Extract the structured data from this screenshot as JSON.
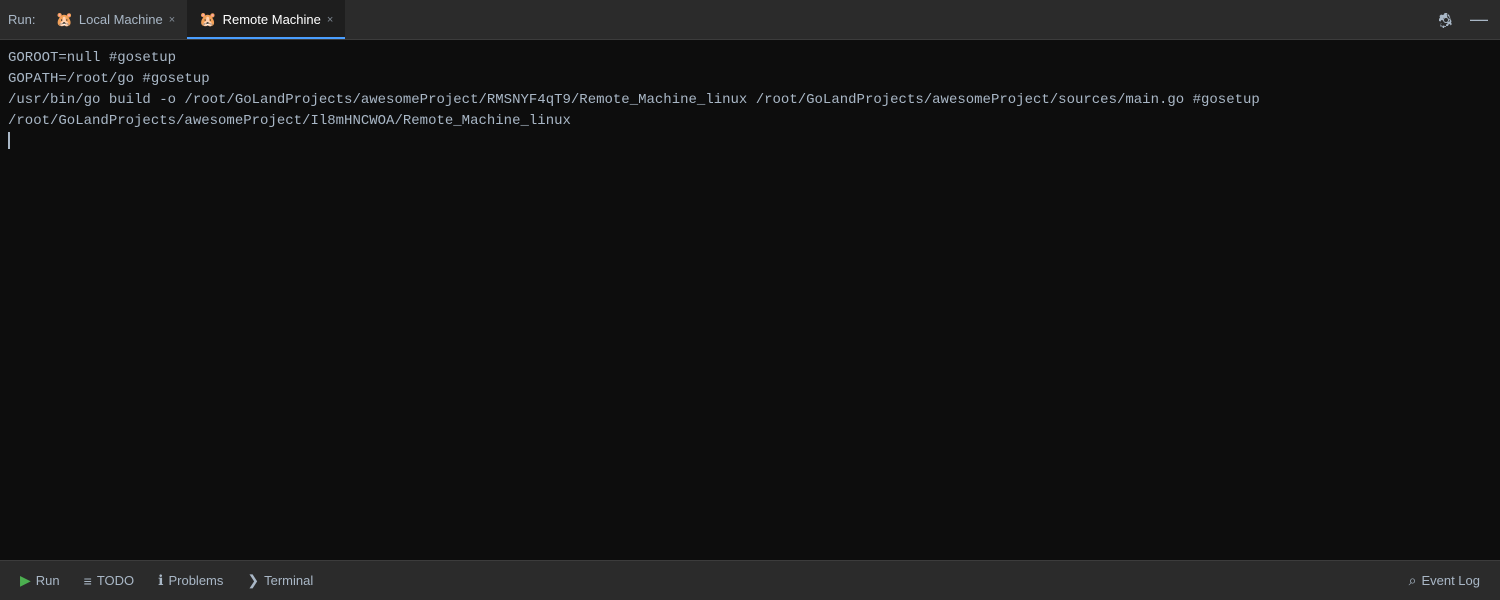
{
  "header": {
    "run_label": "Run:",
    "tabs": [
      {
        "id": "local",
        "label": "Local Machine",
        "icon": "🐹",
        "active": false,
        "closable": true
      },
      {
        "id": "remote",
        "label": "Remote Machine",
        "icon": "🐹",
        "active": true,
        "closable": true
      }
    ]
  },
  "output": {
    "lines": [
      "GOROOT=null #gosetup",
      "GOPATH=/root/go #gosetup",
      "/usr/bin/go build -o /root/GoLandProjects/awesomeProject/RMSNYF4qT9/Remote_Machine_linux /root/GoLandProjects/awesomeProject/sources/main.go #gosetup",
      "/root/GoLandProjects/awesomeProject/Il8mHNCWOA/Remote_Machine_linux",
      ""
    ]
  },
  "statusbar": {
    "run_label": "Run",
    "todo_label": "TODO",
    "problems_label": "Problems",
    "terminal_label": "Terminal",
    "event_log_label": "Event Log"
  },
  "icons": {
    "gear": "⚙",
    "minimize": "—",
    "play": "▶",
    "todo_icon": "≡",
    "problems_icon": "ℹ",
    "terminal_icon": "❯",
    "event_log_icon": "⌕"
  }
}
